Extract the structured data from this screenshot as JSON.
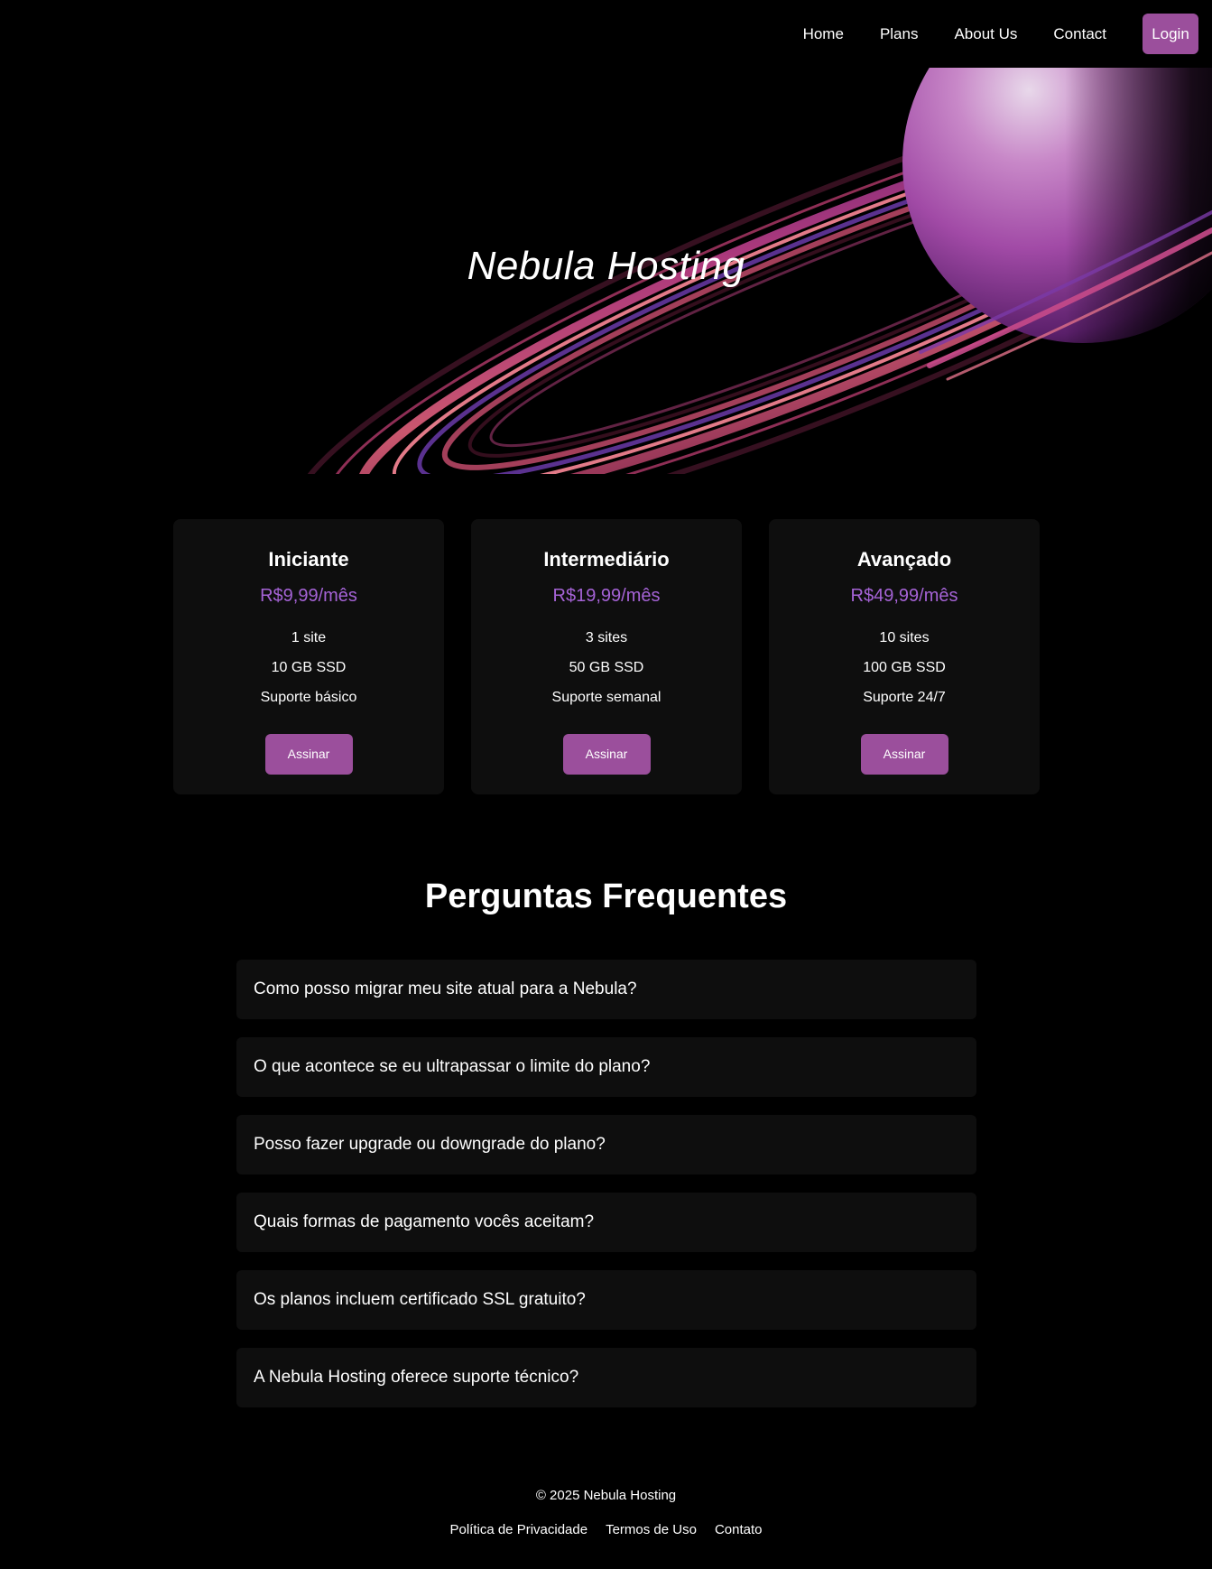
{
  "nav": {
    "items": [
      {
        "label": "Home"
      },
      {
        "label": "Plans"
      },
      {
        "label": "About Us"
      },
      {
        "label": "Contact"
      }
    ],
    "login_label": "Login"
  },
  "hero": {
    "title": "Nebula Hosting"
  },
  "plans": [
    {
      "name": "Iniciante",
      "price": "R$9,99/mês",
      "features": [
        "1 site",
        "10 GB SSD",
        "Suporte básico"
      ],
      "button_label": "Assinar"
    },
    {
      "name": "Intermediário",
      "price": "R$19,99/mês",
      "features": [
        "3 sites",
        "50 GB SSD",
        "Suporte semanal"
      ],
      "button_label": "Assinar"
    },
    {
      "name": "Avançado",
      "price": "R$49,99/mês",
      "features": [
        "10 sites",
        "100 GB SSD",
        "Suporte 24/7"
      ],
      "button_label": "Assinar"
    }
  ],
  "faq": {
    "title": "Perguntas Frequentes",
    "questions": [
      "Como posso migrar meu site atual para a Nebula?",
      "O que acontece se eu ultrapassar o limite do plano?",
      "Posso fazer upgrade ou downgrade do plano?",
      "Quais formas de pagamento vocês aceitam?",
      "Os planos incluem certificado SSL gratuito?",
      "A Nebula Hosting oferece suporte técnico?"
    ]
  },
  "footer": {
    "copyright": "© 2025 Nebula Hosting",
    "links": [
      "Política de Privacidade",
      "Termos de Uso",
      "Contato"
    ]
  },
  "colors": {
    "accent": "#9b4f9c",
    "price": "#a563d6",
    "card_bg": "#0e0e0e",
    "page_bg": "#000000"
  }
}
